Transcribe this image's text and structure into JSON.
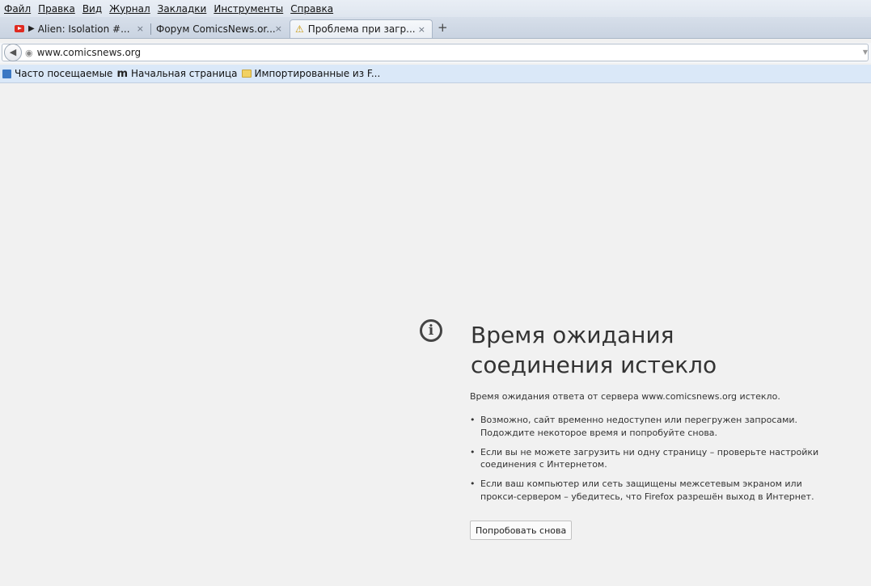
{
  "menu": [
    "Файл",
    "Правка",
    "Вид",
    "Журнал",
    "Закладки",
    "Инструменты",
    "Справка"
  ],
  "tabs": [
    {
      "label": "Alien: Isolation #...",
      "icon": "youtube-icon",
      "playing": true
    },
    {
      "label": "Форум ComicsNews.or...",
      "icon": "none"
    },
    {
      "label": "Проблема при загр...",
      "icon": "warning-icon",
      "active": true
    }
  ],
  "tab_close": "×",
  "new_tab": "+",
  "address": {
    "url": "www.comicsnews.org"
  },
  "bookmarks": [
    {
      "label": "Часто посещаемые"
    },
    {
      "label": "Начальная страница"
    },
    {
      "label": "Импортированные из F..."
    }
  ],
  "error": {
    "title": "Время ожидания соединения истекло",
    "description": "Время ожидания ответа от сервера www.comicsnews.org истекло.",
    "items": [
      "Возможно, сайт временно недоступен или перегружен запросами. Подождите некоторое время и попробуйте снова.",
      "Если вы не можете загрузить ни одну страницу – проверьте настройки соединения с Интернетом.",
      "Если ваш компьютер или сеть защищены межсетевым экраном или прокси-сервером – убедитесь, что Firefox разрешён выход в Интернет."
    ],
    "retry_label": "Попробовать снова"
  }
}
